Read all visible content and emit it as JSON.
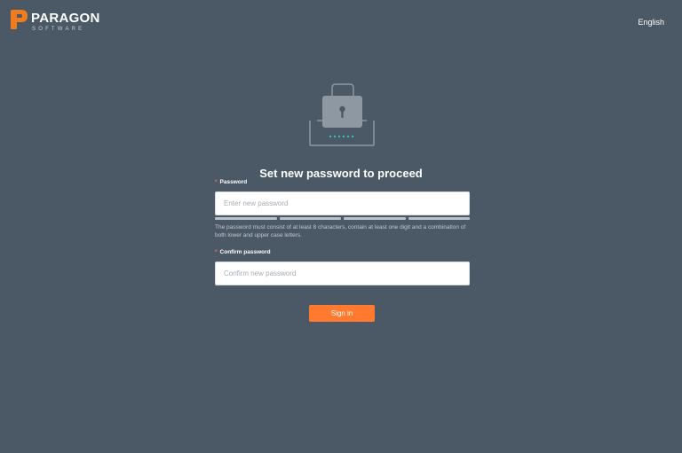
{
  "header": {
    "brand_name": "PARAGON",
    "brand_sub": "SOFTWARE",
    "language": "English"
  },
  "title": "Set new password to proceed",
  "form": {
    "required_mark": "*",
    "password": {
      "label": "Password",
      "value": "",
      "placeholder": "Enter new password"
    },
    "strength_segments": 4,
    "hint": "The password must consist of at least 8 characters, contain at least one digit and a combination of both lower and upper case letters.",
    "confirm": {
      "label": "Confirm password",
      "value": "",
      "placeholder": "Confirm new password"
    },
    "submit_label": "Sign in"
  },
  "icons": {
    "logo": "paragon-logo-icon",
    "illustration": "lock-icon"
  },
  "colors": {
    "background": "#4b5866",
    "accent": "#ff7a2f",
    "required": "#ff6b55",
    "illustration_dots": "#2ec4b6"
  }
}
